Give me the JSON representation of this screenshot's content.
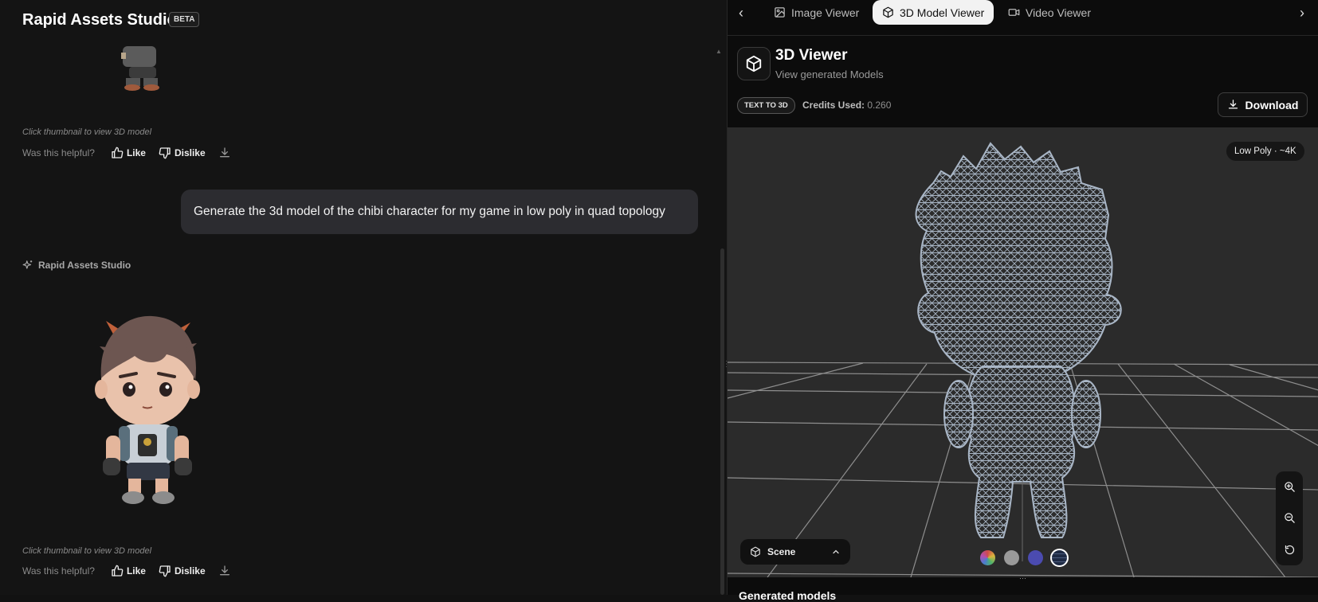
{
  "app": {
    "title": "Rapid Assets Studio",
    "badge": "BETA"
  },
  "chat": {
    "hint_1": "Click thumbnail to view 3D model",
    "hint_2": "Click thumbnail to view 3D model",
    "feedback": {
      "question": "Was this helpful?",
      "like": "Like",
      "dislike": "Dislike"
    },
    "user_message": "Generate the 3d model of the chibi character for my game in low poly in quad topology",
    "assistant_name": "Rapid Assets Studio"
  },
  "viewer_tabs": [
    {
      "label": "Image Viewer",
      "icon": "image-icon",
      "active": false
    },
    {
      "label": "3D Model Viewer",
      "icon": "cube-icon",
      "active": true
    },
    {
      "label": "Video Viewer",
      "icon": "video-icon",
      "active": false
    }
  ],
  "viewer": {
    "title": "3D Viewer",
    "subtitle": "View generated Models",
    "mode_badge": "TEXT TO 3D",
    "credits_label": "Credits Used:",
    "credits_value": "0.260",
    "download_label": "Download",
    "poly_badge": "Low Poly · ~4K",
    "scene_label": "Scene",
    "swatches": [
      {
        "name": "multicolor",
        "color": "#c26b8c"
      },
      {
        "name": "gray",
        "color": "#9a9a9a"
      },
      {
        "name": "blue",
        "color": "#4b4bb0"
      },
      {
        "name": "wireframe",
        "color": "#1e2a44",
        "selected": true
      }
    ],
    "bottom_text": "Generated models"
  },
  "colors": {
    "accent_tab_bg": "#f2f2f2",
    "wireframe": "#a9b6c6",
    "user_bubble": "#2c2c30"
  }
}
